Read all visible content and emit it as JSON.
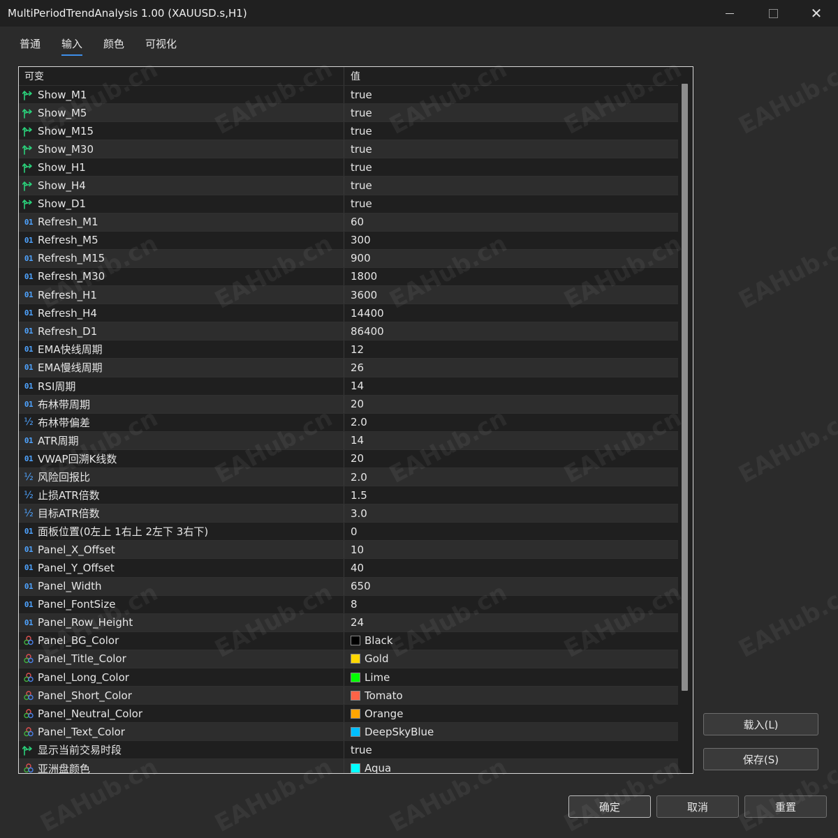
{
  "window": {
    "title": "MultiPeriodTrendAnalysis 1.00 (XAUUSD.s,H1)",
    "close_glyph": "✕"
  },
  "tabs": [
    {
      "label": "普通",
      "active": false
    },
    {
      "label": "输入",
      "active": true
    },
    {
      "label": "颜色",
      "active": false
    },
    {
      "label": "可视化",
      "active": false
    }
  ],
  "grid": {
    "header_name": "可变",
    "header_value": "值",
    "rows": [
      {
        "type": "bool",
        "name": "Show_M1",
        "value": "true"
      },
      {
        "type": "bool",
        "name": "Show_M5",
        "value": "true"
      },
      {
        "type": "bool",
        "name": "Show_M15",
        "value": "true"
      },
      {
        "type": "bool",
        "name": "Show_M30",
        "value": "true"
      },
      {
        "type": "bool",
        "name": "Show_H1",
        "value": "true"
      },
      {
        "type": "bool",
        "name": "Show_H4",
        "value": "true"
      },
      {
        "type": "bool",
        "name": "Show_D1",
        "value": "true"
      },
      {
        "type": "int",
        "name": "Refresh_M1",
        "value": "60"
      },
      {
        "type": "int",
        "name": "Refresh_M5",
        "value": "300"
      },
      {
        "type": "int",
        "name": "Refresh_M15",
        "value": "900"
      },
      {
        "type": "int",
        "name": "Refresh_M30",
        "value": "1800"
      },
      {
        "type": "int",
        "name": "Refresh_H1",
        "value": "3600"
      },
      {
        "type": "int",
        "name": "Refresh_H4",
        "value": "14400"
      },
      {
        "type": "int",
        "name": "Refresh_D1",
        "value": "86400"
      },
      {
        "type": "int",
        "name": "EMA快线周期",
        "value": "12"
      },
      {
        "type": "int",
        "name": "EMA慢线周期",
        "value": "26"
      },
      {
        "type": "int",
        "name": "RSI周期",
        "value": "14"
      },
      {
        "type": "int",
        "name": "布林带周期",
        "value": "20"
      },
      {
        "type": "double",
        "name": "布林带偏差",
        "value": "2.0"
      },
      {
        "type": "int",
        "name": "ATR周期",
        "value": "14"
      },
      {
        "type": "int",
        "name": "VWAP回溯K线数",
        "value": "20"
      },
      {
        "type": "double",
        "name": "风险回报比",
        "value": "2.0"
      },
      {
        "type": "double",
        "name": "止损ATR倍数",
        "value": "1.5"
      },
      {
        "type": "double",
        "name": "目标ATR倍数",
        "value": "3.0"
      },
      {
        "type": "int",
        "name": "面板位置(0左上 1右上 2左下 3右下)",
        "value": "0"
      },
      {
        "type": "int",
        "name": "Panel_X_Offset",
        "value": "10"
      },
      {
        "type": "int",
        "name": "Panel_Y_Offset",
        "value": "40"
      },
      {
        "type": "int",
        "name": "Panel_Width",
        "value": "650"
      },
      {
        "type": "int",
        "name": "Panel_FontSize",
        "value": "8"
      },
      {
        "type": "int",
        "name": "Panel_Row_Height",
        "value": "24"
      },
      {
        "type": "color",
        "name": "Panel_BG_Color",
        "value": "Black",
        "swatch": "#000000"
      },
      {
        "type": "color",
        "name": "Panel_Title_Color",
        "value": "Gold",
        "swatch": "#ffd700"
      },
      {
        "type": "color",
        "name": "Panel_Long_Color",
        "value": "Lime",
        "swatch": "#00ff00"
      },
      {
        "type": "color",
        "name": "Panel_Short_Color",
        "value": "Tomato",
        "swatch": "#ff6347"
      },
      {
        "type": "color",
        "name": "Panel_Neutral_Color",
        "value": "Orange",
        "swatch": "#ffa500"
      },
      {
        "type": "color",
        "name": "Panel_Text_Color",
        "value": "DeepSkyBlue",
        "swatch": "#00bfff"
      },
      {
        "type": "bool",
        "name": "显示当前交易时段",
        "value": "true"
      },
      {
        "type": "color",
        "name": "亚洲盘颜色",
        "value": "Aqua",
        "swatch": "#00ffff"
      }
    ]
  },
  "icons": {
    "int": "01",
    "double": "½",
    "bool": "arrow-branch-icon",
    "color": "palette-icon"
  },
  "buttons": {
    "load": "载入(L)",
    "save": "保存(S)",
    "ok": "确定",
    "cancel": "取消",
    "reset": "重置"
  },
  "watermark": "EAHub.cn"
}
